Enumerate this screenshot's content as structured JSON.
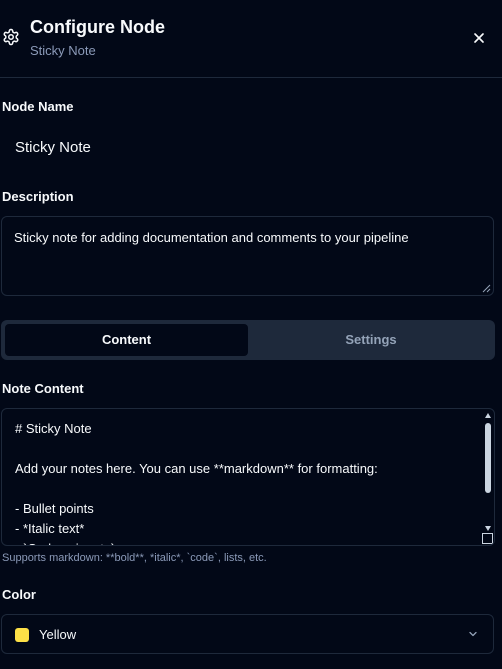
{
  "header": {
    "title": "Configure Node",
    "subtitle": "Sticky Note",
    "icon": "gear-icon",
    "close_icon": "close-icon"
  },
  "node_name": {
    "label": "Node Name",
    "value": "Sticky Note"
  },
  "description": {
    "label": "Description",
    "value": "Sticky note for adding documentation and comments to your pipeline"
  },
  "tabs": [
    {
      "label": "Content",
      "active": true
    },
    {
      "label": "Settings",
      "active": false
    }
  ],
  "note_content": {
    "label": "Note Content",
    "value": "# Sticky Note\n\nAdd your notes here. You can use **markdown** for formatting:\n\n- Bullet points\n- *Italic text*\n- `Code snippets`",
    "hint": "Supports markdown: **bold**, *italic*, `code`, lists, etc."
  },
  "color": {
    "label": "Color",
    "value": "Yellow",
    "swatch": "#fde047"
  },
  "theme": {
    "background": "#020817",
    "border": "#1e293b",
    "muted_text": "#8b9ab8"
  }
}
